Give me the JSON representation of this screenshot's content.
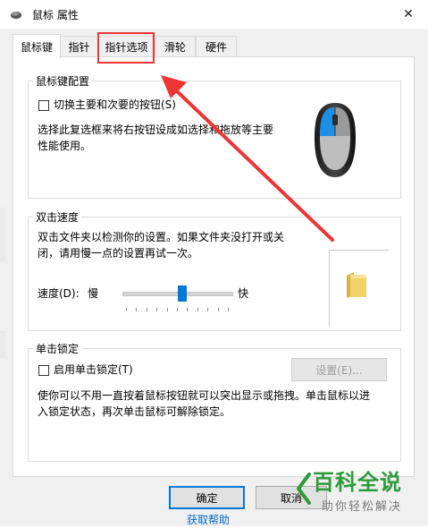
{
  "window": {
    "title": "鼠标 属性",
    "close_glyph": "✕"
  },
  "tabs": [
    {
      "label": "鼠标键",
      "active": true
    },
    {
      "label": "指针",
      "active": false
    },
    {
      "label": "指针选项",
      "active": false
    },
    {
      "label": "滑轮",
      "active": false
    },
    {
      "label": "硬件",
      "active": false
    }
  ],
  "button_config": {
    "title": "鼠标键配置",
    "checkbox_label": "切换主要和次要的按钮(S)",
    "checked": false,
    "desc_line1": "选择此复选框来将右按钮设成如选择和拖放等主要",
    "desc_line2": "性能使用。"
  },
  "double_click": {
    "title": "双击速度",
    "desc_line1": "双击文件夹以检测你的设置。如果文件夹没打开或关",
    "desc_line2": "闭，请用慢一点的设置再试一次。",
    "speed_label": "速度(D):",
    "slow_label": "慢",
    "fast_label": "快",
    "slider_position": 0.55
  },
  "click_lock": {
    "title": "单击锁定",
    "checkbox_label": "启用单击锁定(T)",
    "checked": false,
    "settings_button": "设置(E)...",
    "desc_line1": "使你可以不用一直按着鼠标按钮就可以突出显示或拖拽。单击鼠标以进",
    "desc_line2": "入锁定状态，再次单击鼠标可解除锁定。"
  },
  "footer": {
    "ok": "确定",
    "cancel": "取消",
    "help_link": "获取帮助"
  },
  "watermark": {
    "title": "百科全说",
    "subtitle": "助你轻松解决"
  },
  "colors": {
    "accent": "#0078d7",
    "annotation_red": "#ee3434",
    "watermark_green": "#2e9b3a",
    "folder": "#f2d26b"
  }
}
